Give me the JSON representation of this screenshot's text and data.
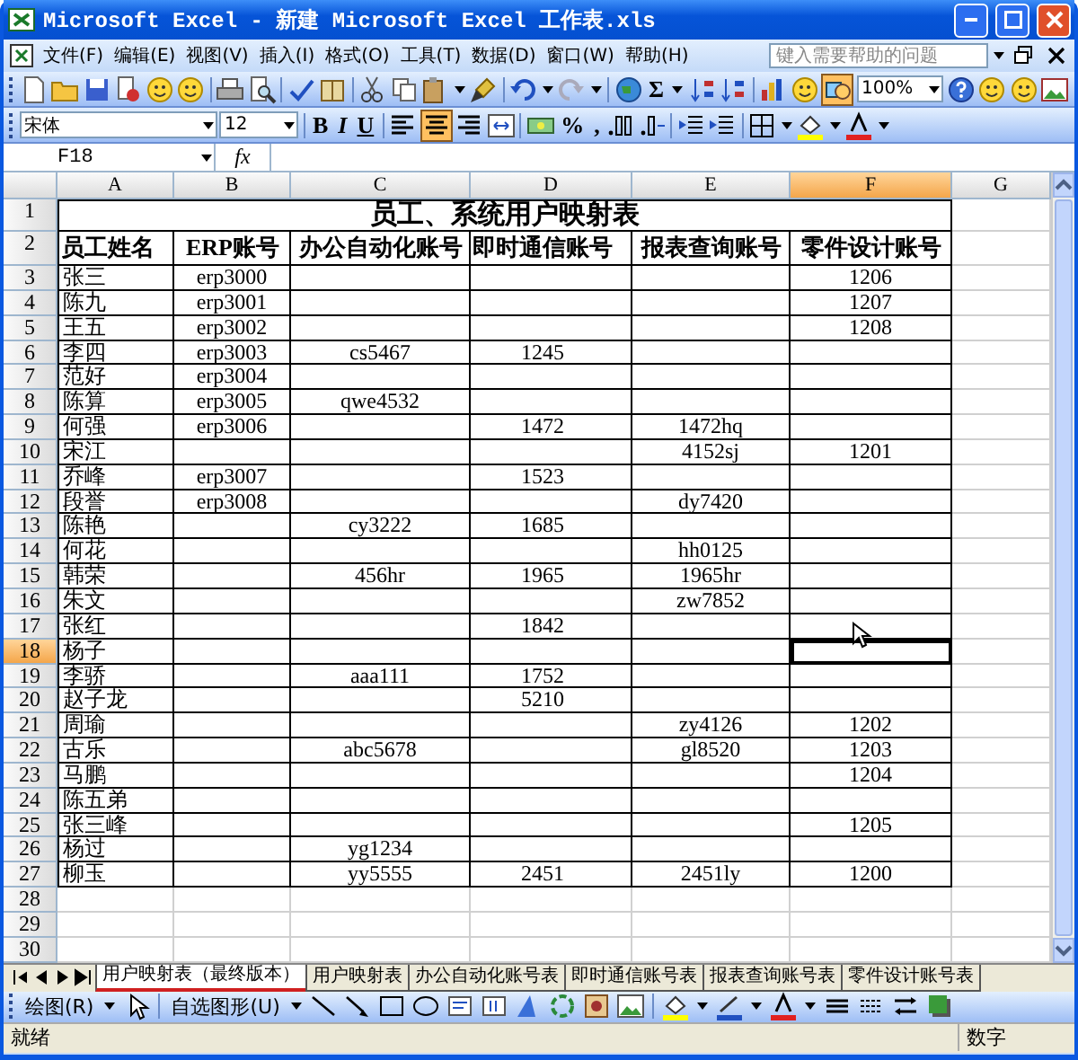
{
  "window": {
    "title": "Microsoft Excel - 新建 Microsoft Excel 工作表.xls"
  },
  "menu": [
    "文件(F)",
    "编辑(E)",
    "视图(V)",
    "插入(I)",
    "格式(O)",
    "工具(T)",
    "数据(D)",
    "窗口(W)",
    "帮助(H)"
  ],
  "help_box": {
    "placeholder": "键入需要帮助的问题"
  },
  "standard_toolbar": {
    "sum": "Σ",
    "zoom": "100%"
  },
  "format_toolbar": {
    "font": "宋体",
    "size": "12",
    "bold": "B",
    "italic": "I",
    "underline": "U",
    "percent": "%",
    "comma": ","
  },
  "formula_bar": {
    "name_box": "F18",
    "fx": "fx"
  },
  "columns": [
    {
      "label": "A",
      "selected": false
    },
    {
      "label": "B",
      "selected": false
    },
    {
      "label": "C",
      "selected": false
    },
    {
      "label": "D",
      "selected": false
    },
    {
      "label": "E",
      "selected": false
    },
    {
      "label": "F",
      "selected": true
    },
    {
      "label": "G",
      "selected": false
    }
  ],
  "rows": [
    {
      "header": "1",
      "selected": false,
      "kind": "title",
      "title": "员工、系统用户映射表"
    },
    {
      "header": "2",
      "selected": false,
      "kind": "header",
      "cells": {
        "A": "员工姓名",
        "B": "ERP账号",
        "C": "办公自动化账号",
        "D": "即时通信账号",
        "E": "报表查询账号",
        "F": "零件设计账号"
      }
    },
    {
      "header": "3",
      "selected": false,
      "kind": "data",
      "cells": {
        "A": "张三",
        "B": "erp3000",
        "F": "1206"
      }
    },
    {
      "header": "4",
      "selected": false,
      "kind": "data",
      "cells": {
        "A": "陈九",
        "B": "erp3001",
        "F": "1207"
      }
    },
    {
      "header": "5",
      "selected": false,
      "kind": "data",
      "cells": {
        "A": "王五",
        "B": "erp3002",
        "F": "1208"
      }
    },
    {
      "header": "6",
      "selected": false,
      "kind": "data",
      "cells": {
        "A": "李四",
        "B": "erp3003",
        "C": "cs5467",
        "D": "1245"
      }
    },
    {
      "header": "7",
      "selected": false,
      "kind": "data",
      "cells": {
        "A": "范好",
        "B": "erp3004"
      }
    },
    {
      "header": "8",
      "selected": false,
      "kind": "data",
      "cells": {
        "A": "陈算",
        "B": "erp3005",
        "C": "qwe4532"
      }
    },
    {
      "header": "9",
      "selected": false,
      "kind": "data",
      "cells": {
        "A": "何强",
        "B": "erp3006",
        "D": "1472",
        "E": "1472hq"
      }
    },
    {
      "header": "10",
      "selected": false,
      "kind": "data",
      "cells": {
        "A": "宋江",
        "E": "4152sj",
        "F": "1201"
      }
    },
    {
      "header": "11",
      "selected": false,
      "kind": "data",
      "cells": {
        "A": "乔峰",
        "B": "erp3007",
        "D": "1523"
      }
    },
    {
      "header": "12",
      "selected": false,
      "kind": "data",
      "cells": {
        "A": "段誉",
        "B": "erp3008",
        "E": "dy7420"
      }
    },
    {
      "header": "13",
      "selected": false,
      "kind": "data",
      "cells": {
        "A": "陈艳",
        "C": "cy3222",
        "D": "1685"
      }
    },
    {
      "header": "14",
      "selected": false,
      "kind": "data",
      "cells": {
        "A": "何花",
        "E": "hh0125"
      }
    },
    {
      "header": "15",
      "selected": false,
      "kind": "data",
      "cells": {
        "A": "韩荣",
        "C": "456hr",
        "D": "1965",
        "E": "1965hr"
      }
    },
    {
      "header": "16",
      "selected": false,
      "kind": "data",
      "cells": {
        "A": "朱文",
        "E": "zw7852"
      }
    },
    {
      "header": "17",
      "selected": false,
      "kind": "data",
      "cells": {
        "A": "张红",
        "D": "1842"
      }
    },
    {
      "header": "18",
      "selected": true,
      "kind": "data",
      "cells": {
        "A": "杨子"
      }
    },
    {
      "header": "19",
      "selected": false,
      "kind": "data",
      "cells": {
        "A": "李骄",
        "C": "aaa111",
        "D": "1752"
      }
    },
    {
      "header": "20",
      "selected": false,
      "kind": "data",
      "cells": {
        "A": "赵子龙",
        "D": "5210"
      }
    },
    {
      "header": "21",
      "selected": false,
      "kind": "data",
      "cells": {
        "A": "周瑜",
        "E": "zy4126",
        "F": "1202"
      }
    },
    {
      "header": "22",
      "selected": false,
      "kind": "data",
      "cells": {
        "A": "古乐",
        "C": "abc5678",
        "E": "gl8520",
        "F": "1203"
      }
    },
    {
      "header": "23",
      "selected": false,
      "kind": "data",
      "cells": {
        "A": "马鹏",
        "F": "1204"
      }
    },
    {
      "header": "24",
      "selected": false,
      "kind": "data",
      "cells": {
        "A": "陈五弟"
      }
    },
    {
      "header": "25",
      "selected": false,
      "kind": "data",
      "cells": {
        "A": "张三峰",
        "F": "1205"
      }
    },
    {
      "header": "26",
      "selected": false,
      "kind": "data",
      "cells": {
        "A": "杨过",
        "C": "yg1234"
      }
    },
    {
      "header": "27",
      "selected": false,
      "kind": "data",
      "cells": {
        "A": "柳玉",
        "C": "yy5555",
        "D": "2451",
        "E": "2451ly",
        "F": "1200"
      }
    },
    {
      "header": "28",
      "selected": false,
      "kind": "blank"
    },
    {
      "header": "29",
      "selected": false,
      "kind": "blank"
    },
    {
      "header": "30",
      "selected": false,
      "kind": "blank"
    }
  ],
  "sheet_tabs": [
    {
      "label": "用户映射表（最终版本）",
      "selected": true
    },
    {
      "label": "用户映射表",
      "selected": false
    },
    {
      "label": "办公自动化账号表",
      "selected": false
    },
    {
      "label": "即时通信账号表",
      "selected": false
    },
    {
      "label": "报表查询账号表",
      "selected": false
    },
    {
      "label": "零件设计账号表",
      "selected": false
    }
  ],
  "drawing_toolbar": {
    "draw": "绘图(R)",
    "autoshapes": "自选图形(U)"
  },
  "status_bar": {
    "left": "就绪",
    "right": "数字"
  }
}
